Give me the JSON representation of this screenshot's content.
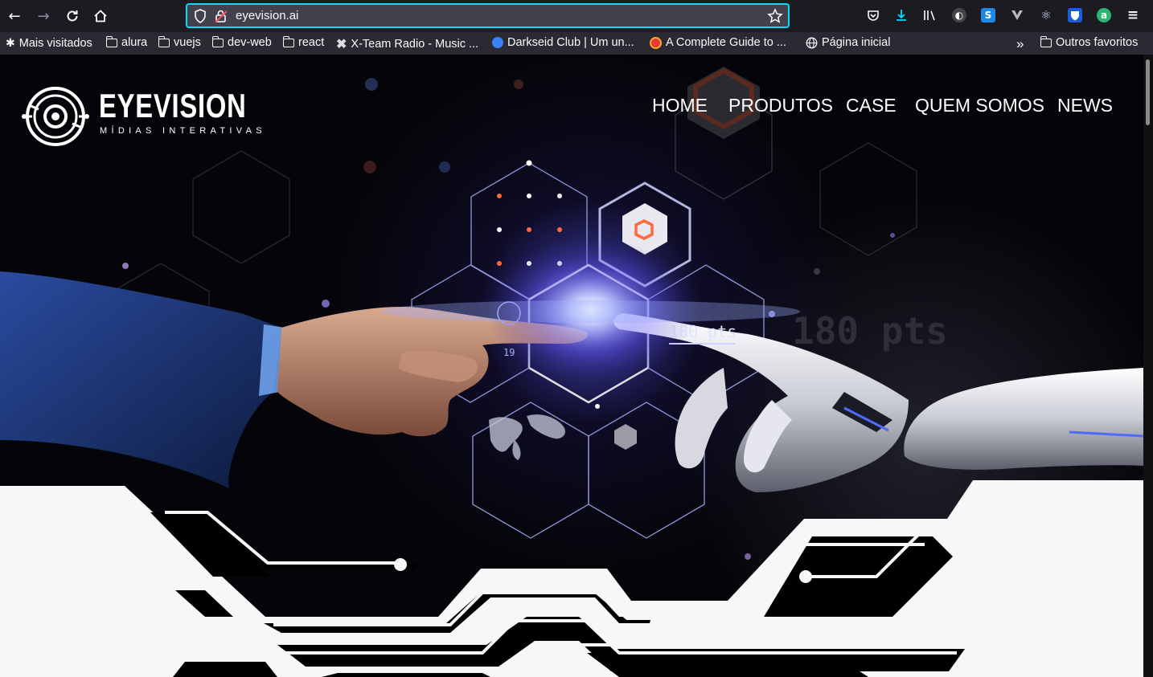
{
  "browser": {
    "url": "eyevision.ai",
    "bookmarks": [
      {
        "label": "Mais visitados",
        "icon": "gear-icon"
      },
      {
        "label": "alura",
        "icon": "folder-icon"
      },
      {
        "label": "vuejs",
        "icon": "folder-icon"
      },
      {
        "label": "dev-web",
        "icon": "folder-icon"
      },
      {
        "label": "react",
        "icon": "folder-icon"
      },
      {
        "label": "X-Team Radio - Music ...",
        "icon": "xteam-icon"
      },
      {
        "label": "Darkseid Club | Um un...",
        "icon": "darkseid-icon"
      },
      {
        "label": "A Complete Guide to ...",
        "icon": "guide-icon"
      },
      {
        "label": "Página inicial",
        "icon": "globe-icon"
      }
    ],
    "other_bookmarks": "Outros favoritos"
  },
  "site": {
    "brand": "EYEVISION",
    "tagline": "MÍDIAS INTERATIVAS",
    "nav": [
      "HOME",
      "PRODUTOS",
      "CASE",
      "QUEM SOMOS",
      "NEWS"
    ],
    "hud_text": "180 pts",
    "hud_text_bg": "180 pts",
    "hex_number": "19"
  },
  "colors": {
    "accent_cyan": "#00ddff",
    "toolbar_bg": "#1c1b22",
    "bookmarks_bg": "#2b2a33",
    "hex_orange": "#ff6a3d",
    "light_panel": "#f7f7f7"
  }
}
